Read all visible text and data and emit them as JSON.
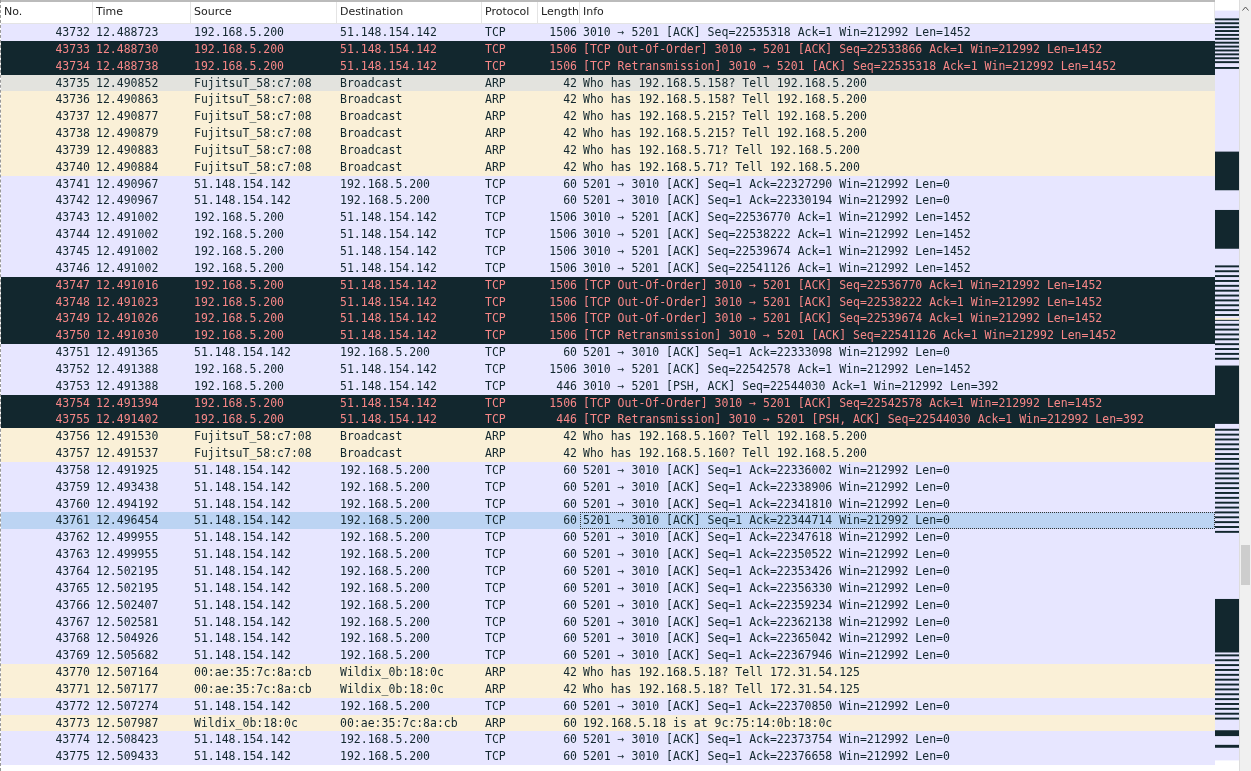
{
  "columns": [
    "No.",
    "Time",
    "Source",
    "Destination",
    "Protocol",
    "Length",
    "Info"
  ],
  "rows": [
    {
      "no": "43732",
      "time": "12.488723",
      "source": "192.168.5.200",
      "destination": "51.148.154.142",
      "protocol": "TCP",
      "length": "1506",
      "info": "3010 → 5201 [ACK] Seq=22535318 Ack=1 Win=212992 Len=1452",
      "kind": "tcp",
      "selected": false,
      "hovered": false
    },
    {
      "no": "43733",
      "time": "12.488730",
      "source": "192.168.5.200",
      "destination": "51.148.154.142",
      "protocol": "TCP",
      "length": "1506",
      "info": "[TCP Out-Of-Order] 3010 → 5201 [ACK] Seq=22533866 Ack=1 Win=212992 Len=1452",
      "kind": "bad",
      "selected": false,
      "hovered": false
    },
    {
      "no": "43734",
      "time": "12.488738",
      "source": "192.168.5.200",
      "destination": "51.148.154.142",
      "protocol": "TCP",
      "length": "1506",
      "info": "[TCP Retransmission] 3010 → 5201 [ACK] Seq=22535318 Ack=1 Win=212992 Len=1452",
      "kind": "bad",
      "selected": false,
      "hovered": false
    },
    {
      "no": "43735",
      "time": "12.490852",
      "source": "FujitsuT_58:c7:08",
      "destination": "Broadcast",
      "protocol": "ARP",
      "length": "42",
      "info": "Who has 192.168.5.158? Tell 192.168.5.200",
      "kind": "arp",
      "selected": false,
      "hovered": true
    },
    {
      "no": "43736",
      "time": "12.490863",
      "source": "FujitsuT_58:c7:08",
      "destination": "Broadcast",
      "protocol": "ARP",
      "length": "42",
      "info": "Who has 192.168.5.158? Tell 192.168.5.200",
      "kind": "arp",
      "selected": false,
      "hovered": false
    },
    {
      "no": "43737",
      "time": "12.490877",
      "source": "FujitsuT_58:c7:08",
      "destination": "Broadcast",
      "protocol": "ARP",
      "length": "42",
      "info": "Who has 192.168.5.215? Tell 192.168.5.200",
      "kind": "arp",
      "selected": false,
      "hovered": false
    },
    {
      "no": "43738",
      "time": "12.490879",
      "source": "FujitsuT_58:c7:08",
      "destination": "Broadcast",
      "protocol": "ARP",
      "length": "42",
      "info": "Who has 192.168.5.215? Tell 192.168.5.200",
      "kind": "arp",
      "selected": false,
      "hovered": false
    },
    {
      "no": "43739",
      "time": "12.490883",
      "source": "FujitsuT_58:c7:08",
      "destination": "Broadcast",
      "protocol": "ARP",
      "length": "42",
      "info": "Who has 192.168.5.71? Tell 192.168.5.200",
      "kind": "arp",
      "selected": false,
      "hovered": false
    },
    {
      "no": "43740",
      "time": "12.490884",
      "source": "FujitsuT_58:c7:08",
      "destination": "Broadcast",
      "protocol": "ARP",
      "length": "42",
      "info": "Who has 192.168.5.71? Tell 192.168.5.200",
      "kind": "arp",
      "selected": false,
      "hovered": false
    },
    {
      "no": "43741",
      "time": "12.490967",
      "source": "51.148.154.142",
      "destination": "192.168.5.200",
      "protocol": "TCP",
      "length": "60",
      "info": "5201 → 3010 [ACK] Seq=1 Ack=22327290 Win=212992 Len=0",
      "kind": "tcp",
      "selected": false,
      "hovered": false
    },
    {
      "no": "43742",
      "time": "12.490967",
      "source": "51.148.154.142",
      "destination": "192.168.5.200",
      "protocol": "TCP",
      "length": "60",
      "info": "5201 → 3010 [ACK] Seq=1 Ack=22330194 Win=212992 Len=0",
      "kind": "tcp",
      "selected": false,
      "hovered": false
    },
    {
      "no": "43743",
      "time": "12.491002",
      "source": "192.168.5.200",
      "destination": "51.148.154.142",
      "protocol": "TCP",
      "length": "1506",
      "info": "3010 → 5201 [ACK] Seq=22536770 Ack=1 Win=212992 Len=1452",
      "kind": "tcp",
      "selected": false,
      "hovered": false
    },
    {
      "no": "43744",
      "time": "12.491002",
      "source": "192.168.5.200",
      "destination": "51.148.154.142",
      "protocol": "TCP",
      "length": "1506",
      "info": "3010 → 5201 [ACK] Seq=22538222 Ack=1 Win=212992 Len=1452",
      "kind": "tcp",
      "selected": false,
      "hovered": false
    },
    {
      "no": "43745",
      "time": "12.491002",
      "source": "192.168.5.200",
      "destination": "51.148.154.142",
      "protocol": "TCP",
      "length": "1506",
      "info": "3010 → 5201 [ACK] Seq=22539674 Ack=1 Win=212992 Len=1452",
      "kind": "tcp",
      "selected": false,
      "hovered": false
    },
    {
      "no": "43746",
      "time": "12.491002",
      "source": "192.168.5.200",
      "destination": "51.148.154.142",
      "protocol": "TCP",
      "length": "1506",
      "info": "3010 → 5201 [ACK] Seq=22541126 Ack=1 Win=212992 Len=1452",
      "kind": "tcp",
      "selected": false,
      "hovered": false
    },
    {
      "no": "43747",
      "time": "12.491016",
      "source": "192.168.5.200",
      "destination": "51.148.154.142",
      "protocol": "TCP",
      "length": "1506",
      "info": "[TCP Out-Of-Order] 3010 → 5201 [ACK] Seq=22536770 Ack=1 Win=212992 Len=1452",
      "kind": "bad",
      "selected": false,
      "hovered": false
    },
    {
      "no": "43748",
      "time": "12.491023",
      "source": "192.168.5.200",
      "destination": "51.148.154.142",
      "protocol": "TCP",
      "length": "1506",
      "info": "[TCP Out-Of-Order] 3010 → 5201 [ACK] Seq=22538222 Ack=1 Win=212992 Len=1452",
      "kind": "bad",
      "selected": false,
      "hovered": false
    },
    {
      "no": "43749",
      "time": "12.491026",
      "source": "192.168.5.200",
      "destination": "51.148.154.142",
      "protocol": "TCP",
      "length": "1506",
      "info": "[TCP Out-Of-Order] 3010 → 5201 [ACK] Seq=22539674 Ack=1 Win=212992 Len=1452",
      "kind": "bad",
      "selected": false,
      "hovered": false
    },
    {
      "no": "43750",
      "time": "12.491030",
      "source": "192.168.5.200",
      "destination": "51.148.154.142",
      "protocol": "TCP",
      "length": "1506",
      "info": "[TCP Retransmission] 3010 → 5201 [ACK] Seq=22541126 Ack=1 Win=212992 Len=1452",
      "kind": "bad",
      "selected": false,
      "hovered": false
    },
    {
      "no": "43751",
      "time": "12.491365",
      "source": "51.148.154.142",
      "destination": "192.168.5.200",
      "protocol": "TCP",
      "length": "60",
      "info": "5201 → 3010 [ACK] Seq=1 Ack=22333098 Win=212992 Len=0",
      "kind": "tcp",
      "selected": false,
      "hovered": false
    },
    {
      "no": "43752",
      "time": "12.491388",
      "source": "192.168.5.200",
      "destination": "51.148.154.142",
      "protocol": "TCP",
      "length": "1506",
      "info": "3010 → 5201 [ACK] Seq=22542578 Ack=1 Win=212992 Len=1452",
      "kind": "tcp",
      "selected": false,
      "hovered": false
    },
    {
      "no": "43753",
      "time": "12.491388",
      "source": "192.168.5.200",
      "destination": "51.148.154.142",
      "protocol": "TCP",
      "length": "446",
      "info": "3010 → 5201 [PSH, ACK] Seq=22544030 Ack=1 Win=212992 Len=392",
      "kind": "tcp",
      "selected": false,
      "hovered": false
    },
    {
      "no": "43754",
      "time": "12.491394",
      "source": "192.168.5.200",
      "destination": "51.148.154.142",
      "protocol": "TCP",
      "length": "1506",
      "info": "[TCP Out-Of-Order] 3010 → 5201 [ACK] Seq=22542578 Ack=1 Win=212992 Len=1452",
      "kind": "bad",
      "selected": false,
      "hovered": false
    },
    {
      "no": "43755",
      "time": "12.491402",
      "source": "192.168.5.200",
      "destination": "51.148.154.142",
      "protocol": "TCP",
      "length": "446",
      "info": "[TCP Retransmission] 3010 → 5201 [PSH, ACK] Seq=22544030 Ack=1 Win=212992 Len=392",
      "kind": "bad",
      "selected": false,
      "hovered": false
    },
    {
      "no": "43756",
      "time": "12.491530",
      "source": "FujitsuT_58:c7:08",
      "destination": "Broadcast",
      "protocol": "ARP",
      "length": "42",
      "info": "Who has 192.168.5.160? Tell 192.168.5.200",
      "kind": "arp",
      "selected": false,
      "hovered": false
    },
    {
      "no": "43757",
      "time": "12.491537",
      "source": "FujitsuT_58:c7:08",
      "destination": "Broadcast",
      "protocol": "ARP",
      "length": "42",
      "info": "Who has 192.168.5.160? Tell 192.168.5.200",
      "kind": "arp",
      "selected": false,
      "hovered": false
    },
    {
      "no": "43758",
      "time": "12.491925",
      "source": "51.148.154.142",
      "destination": "192.168.5.200",
      "protocol": "TCP",
      "length": "60",
      "info": "5201 → 3010 [ACK] Seq=1 Ack=22336002 Win=212992 Len=0",
      "kind": "tcp",
      "selected": false,
      "hovered": false
    },
    {
      "no": "43759",
      "time": "12.493438",
      "source": "51.148.154.142",
      "destination": "192.168.5.200",
      "protocol": "TCP",
      "length": "60",
      "info": "5201 → 3010 [ACK] Seq=1 Ack=22338906 Win=212992 Len=0",
      "kind": "tcp",
      "selected": false,
      "hovered": false
    },
    {
      "no": "43760",
      "time": "12.494192",
      "source": "51.148.154.142",
      "destination": "192.168.5.200",
      "protocol": "TCP",
      "length": "60",
      "info": "5201 → 3010 [ACK] Seq=1 Ack=22341810 Win=212992 Len=0",
      "kind": "tcp",
      "selected": false,
      "hovered": false
    },
    {
      "no": "43761",
      "time": "12.496454",
      "source": "51.148.154.142",
      "destination": "192.168.5.200",
      "protocol": "TCP",
      "length": "60",
      "info": "5201 → 3010 [ACK] Seq=1 Ack=22344714 Win=212992 Len=0",
      "kind": "tcp",
      "selected": true,
      "hovered": false
    },
    {
      "no": "43762",
      "time": "12.499955",
      "source": "51.148.154.142",
      "destination": "192.168.5.200",
      "protocol": "TCP",
      "length": "60",
      "info": "5201 → 3010 [ACK] Seq=1 Ack=22347618 Win=212992 Len=0",
      "kind": "tcp",
      "selected": false,
      "hovered": false
    },
    {
      "no": "43763",
      "time": "12.499955",
      "source": "51.148.154.142",
      "destination": "192.168.5.200",
      "protocol": "TCP",
      "length": "60",
      "info": "5201 → 3010 [ACK] Seq=1 Ack=22350522 Win=212992 Len=0",
      "kind": "tcp",
      "selected": false,
      "hovered": false
    },
    {
      "no": "43764",
      "time": "12.502195",
      "source": "51.148.154.142",
      "destination": "192.168.5.200",
      "protocol": "TCP",
      "length": "60",
      "info": "5201 → 3010 [ACK] Seq=1 Ack=22353426 Win=212992 Len=0",
      "kind": "tcp",
      "selected": false,
      "hovered": false
    },
    {
      "no": "43765",
      "time": "12.502195",
      "source": "51.148.154.142",
      "destination": "192.168.5.200",
      "protocol": "TCP",
      "length": "60",
      "info": "5201 → 3010 [ACK] Seq=1 Ack=22356330 Win=212992 Len=0",
      "kind": "tcp",
      "selected": false,
      "hovered": false
    },
    {
      "no": "43766",
      "time": "12.502407",
      "source": "51.148.154.142",
      "destination": "192.168.5.200",
      "protocol": "TCP",
      "length": "60",
      "info": "5201 → 3010 [ACK] Seq=1 Ack=22359234 Win=212992 Len=0",
      "kind": "tcp",
      "selected": false,
      "hovered": false
    },
    {
      "no": "43767",
      "time": "12.502581",
      "source": "51.148.154.142",
      "destination": "192.168.5.200",
      "protocol": "TCP",
      "length": "60",
      "info": "5201 → 3010 [ACK] Seq=1 Ack=22362138 Win=212992 Len=0",
      "kind": "tcp",
      "selected": false,
      "hovered": false
    },
    {
      "no": "43768",
      "time": "12.504926",
      "source": "51.148.154.142",
      "destination": "192.168.5.200",
      "protocol": "TCP",
      "length": "60",
      "info": "5201 → 3010 [ACK] Seq=1 Ack=22365042 Win=212992 Len=0",
      "kind": "tcp",
      "selected": false,
      "hovered": false
    },
    {
      "no": "43769",
      "time": "12.505682",
      "source": "51.148.154.142",
      "destination": "192.168.5.200",
      "protocol": "TCP",
      "length": "60",
      "info": "5201 → 3010 [ACK] Seq=1 Ack=22367946 Win=212992 Len=0",
      "kind": "tcp",
      "selected": false,
      "hovered": false
    },
    {
      "no": "43770",
      "time": "12.507164",
      "source": "00:ae:35:7c:8a:cb",
      "destination": "Wildix_0b:18:0c",
      "protocol": "ARP",
      "length": "42",
      "info": "Who has 192.168.5.18? Tell 172.31.54.125",
      "kind": "arp",
      "selected": false,
      "hovered": false
    },
    {
      "no": "43771",
      "time": "12.507177",
      "source": "00:ae:35:7c:8a:cb",
      "destination": "Wildix_0b:18:0c",
      "protocol": "ARP",
      "length": "42",
      "info": "Who has 192.168.5.18? Tell 172.31.54.125",
      "kind": "arp",
      "selected": false,
      "hovered": false
    },
    {
      "no": "43772",
      "time": "12.507274",
      "source": "51.148.154.142",
      "destination": "192.168.5.200",
      "protocol": "TCP",
      "length": "60",
      "info": "5201 → 3010 [ACK] Seq=1 Ack=22370850 Win=212992 Len=0",
      "kind": "tcp",
      "selected": false,
      "hovered": false
    },
    {
      "no": "43773",
      "time": "12.507987",
      "source": "Wildix_0b:18:0c",
      "destination": "00:ae:35:7c:8a:cb",
      "protocol": "ARP",
      "length": "60",
      "info": "192.168.5.18 is at 9c:75:14:0b:18:0c",
      "kind": "arp",
      "selected": false,
      "hovered": false
    },
    {
      "no": "43774",
      "time": "12.508423",
      "source": "51.148.154.142",
      "destination": "192.168.5.200",
      "protocol": "TCP",
      "length": "60",
      "info": "5201 → 3010 [ACK] Seq=1 Ack=22373754 Win=212992 Len=0",
      "kind": "tcp",
      "selected": false,
      "hovered": false
    },
    {
      "no": "43775",
      "time": "12.509433",
      "source": "51.148.154.142",
      "destination": "192.168.5.200",
      "protocol": "TCP",
      "length": "60",
      "info": "5201 → 3010 [ACK] Seq=1 Ack=22376658 Win=212992 Len=0",
      "kind": "tcp",
      "selected": false,
      "hovered": false
    }
  ]
}
